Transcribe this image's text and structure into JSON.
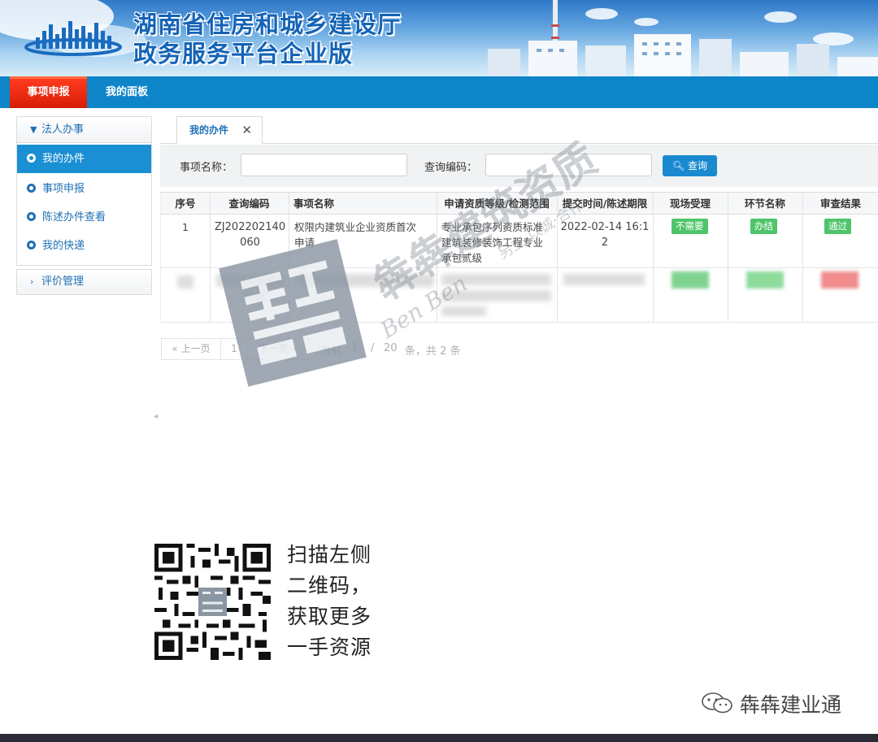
{
  "banner": {
    "title_line1": "湖南省住房和城乡建设厅",
    "title_line2": "政务服务平台企业版"
  },
  "nav": {
    "tabs": [
      {
        "label": "事项申报",
        "active": true
      },
      {
        "label": "我的面板",
        "active": false
      }
    ]
  },
  "sidebar": {
    "group1_title": "法人办事",
    "items": [
      {
        "label": "我的办件",
        "active": true
      },
      {
        "label": "事项申报",
        "active": false
      },
      {
        "label": "陈述办件查看",
        "active": false
      },
      {
        "label": "我的快递",
        "active": false
      }
    ],
    "group2_title": "评价管理"
  },
  "tab": {
    "label": "我的办件",
    "close": "✕"
  },
  "search": {
    "name_label": "事项名称：",
    "name_value": "",
    "code_label": "查询编码：",
    "code_value": "",
    "button_label": "查询"
  },
  "table": {
    "headers": [
      "序号",
      "查询编码",
      "事项名称",
      "申请资质等级/检测范围",
      "提交时间/陈述期限",
      "现场受理",
      "环节名称",
      "审查结果"
    ],
    "row1": {
      "index": "1",
      "code_line1": "ZJ202202140",
      "code_line2": "060",
      "name_line1": "权限内建筑业企业资质首次",
      "name_line2": "申请",
      "scope_line1": "专业承包序列资质标准",
      "scope_line2": "建筑装修装饰工程专业",
      "scope_line3": "承包贰级",
      "time_line1": "2022-02-14 16:1",
      "time_line2": "2",
      "onsite": "不需要",
      "stage": "办结",
      "result": "通过"
    }
  },
  "pager": {
    "prev": "« 上一页",
    "page": "1",
    "next": "下一页 »",
    "current_label": "当前",
    "current_page": "1",
    "slash": "/",
    "per_page": "20",
    "summary": "条，共 2 条"
  },
  "watermark": {
    "line1": "犇犇建筑资质",
    "line2": "Ben Ben",
    "line3": "另立·以诚·合作"
  },
  "promo": {
    "line1": "扫描左侧",
    "line2": "二维码，",
    "line3": "获取更多",
    "line4": "一手资源"
  },
  "wechat": {
    "account": "犇犇建业通"
  },
  "colors": {
    "nav_blue": "#0f85c9",
    "active_red": "#d71d05",
    "badge_green": "#4fc46a",
    "link_blue": "#1f6fb5"
  }
}
